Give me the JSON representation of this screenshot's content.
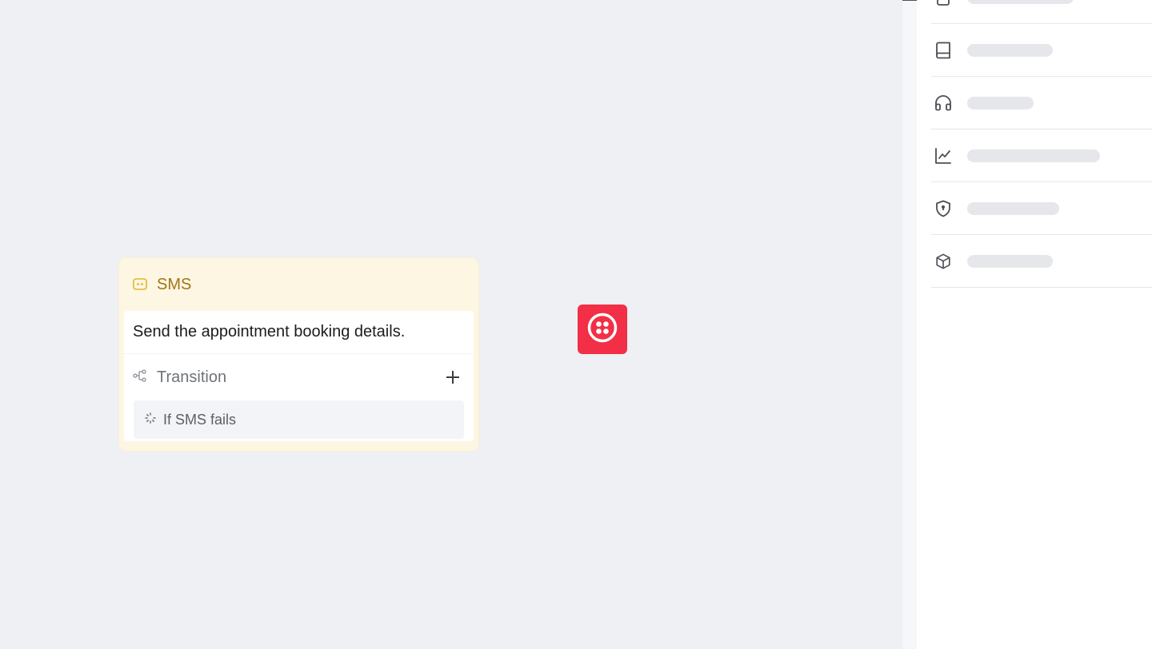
{
  "node": {
    "type_label": "SMS",
    "description": "Send the appointment booking details.",
    "transition_label": "Transition",
    "conditions": [
      "If SMS fails"
    ]
  },
  "colors": {
    "canvas": "#eef0f3",
    "node_header_bg": "#fdf6e3",
    "node_title": "#a37513",
    "badge": "#f22f46"
  },
  "badge": {
    "icon": "twilio-icon"
  },
  "panel": {
    "items": [
      {
        "icon": "document-icon"
      },
      {
        "icon": "book-icon"
      },
      {
        "icon": "headphones-icon"
      },
      {
        "icon": "line-chart-icon"
      },
      {
        "icon": "shield-icon"
      },
      {
        "icon": "cube-icon"
      }
    ]
  }
}
